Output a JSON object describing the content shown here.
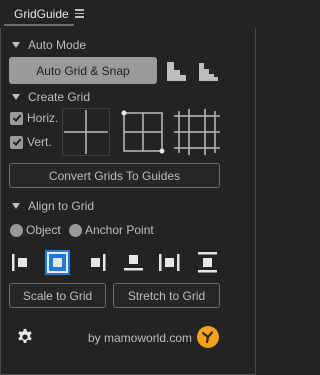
{
  "panel": {
    "title": "GridGuide"
  },
  "auto_mode": {
    "section_label": "Auto Mode",
    "button_label": "Auto Grid & Snap"
  },
  "create_grid": {
    "section_label": "Create Grid",
    "horiz_label": "Horiz.",
    "vert_label": "Vert.",
    "horiz_checked": true,
    "vert_checked": true,
    "convert_button": "Convert Grids To Guides"
  },
  "align_to_grid": {
    "section_label": "Align to Grid",
    "object_label": "Object",
    "anchor_label": "Anchor Point",
    "scale_button": "Scale to Grid",
    "stretch_button": "Stretch to Grid"
  },
  "footer": {
    "credit": "by mamoworld.com"
  },
  "colors": {
    "accent_blue": "#1f7bd8",
    "logo_orange": "#f5a21b",
    "panel_bg": "#232323"
  }
}
